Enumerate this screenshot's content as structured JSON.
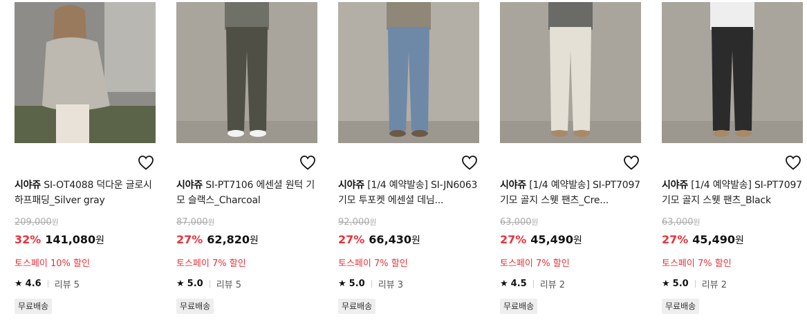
{
  "products": [
    {
      "brand": "시야쥬",
      "name": " SI-OT4088 덕다운 글로시 하프패딩_Silver gray",
      "original_price": "209,000",
      "discount": "32%",
      "price": "141,080",
      "currency": "원",
      "toss_promo": "토스페이 10% 할인",
      "rating": "4.6",
      "review_label": "리뷰 5",
      "shipping": "무료배송",
      "image": {
        "kind": "puffer",
        "bg": "#8e8c88",
        "item": "#bdb8b0",
        "bottom": "#e8e2d8"
      }
    },
    {
      "brand": "시야쥬",
      "name": " SI-PT7106 에센셜 원턱 기모 슬랙스_Charcoal",
      "original_price": "87,000",
      "discount": "27%",
      "price": "62,820",
      "currency": "원",
      "toss_promo": "토스페이 7% 할인",
      "rating": "5.0",
      "review_label": "리뷰 5",
      "shipping": "무료배송",
      "image": {
        "kind": "pants",
        "bg": "#a9a59d",
        "item": "#4f4f46",
        "top": "#6f7068",
        "shoe": "#f3f3f1"
      }
    },
    {
      "brand": "시야쥬",
      "name": " [1/4 예약발송] SI-JN6063 기모 투포켓 에센셜 데님...",
      "original_price": "92,000",
      "discount": "27%",
      "price": "66,430",
      "currency": "원",
      "toss_promo": "토스페이 7% 할인",
      "rating": "5.0",
      "review_label": "리뷰 3",
      "shipping": "무료배송",
      "image": {
        "kind": "pants",
        "bg": "#b3aea6",
        "item": "#6e88a8",
        "top": "#8f8778",
        "shoe": "#6b5a48"
      }
    },
    {
      "brand": "시야쥬",
      "name": " [1/4 예약발송] SI-PT7097 기모 골지 스웻 팬츠_Cre...",
      "original_price": "63,000",
      "discount": "27%",
      "price": "45,490",
      "currency": "원",
      "toss_promo": "토스페이 7% 할인",
      "rating": "4.5",
      "review_label": "리뷰 2",
      "shipping": "무료배송",
      "image": {
        "kind": "pants",
        "bg": "#aaa59c",
        "item": "#e4e0d6",
        "top": "#6a6a66",
        "shoe": "#a88a68"
      }
    },
    {
      "brand": "시야쥬",
      "name": " [1/4 예약발송] SI-PT7097 기모 골지 스웻 팬츠_Black",
      "original_price": "63,000",
      "discount": "27%",
      "price": "45,490",
      "currency": "원",
      "toss_promo": "토스페이 7% 할인",
      "rating": "5.0",
      "review_label": "리뷰 2",
      "shipping": "무료배송",
      "image": {
        "kind": "pants",
        "bg": "#a9a49c",
        "item": "#2b2b2c",
        "top": "#eeeeee",
        "shoe": "#a88a68"
      }
    }
  ],
  "colors": {
    "discount": "#e8323a",
    "badge_bg": "#eeeeee"
  },
  "icons": {
    "wishlist": "heart-outline-icon",
    "rating": "star-icon"
  }
}
